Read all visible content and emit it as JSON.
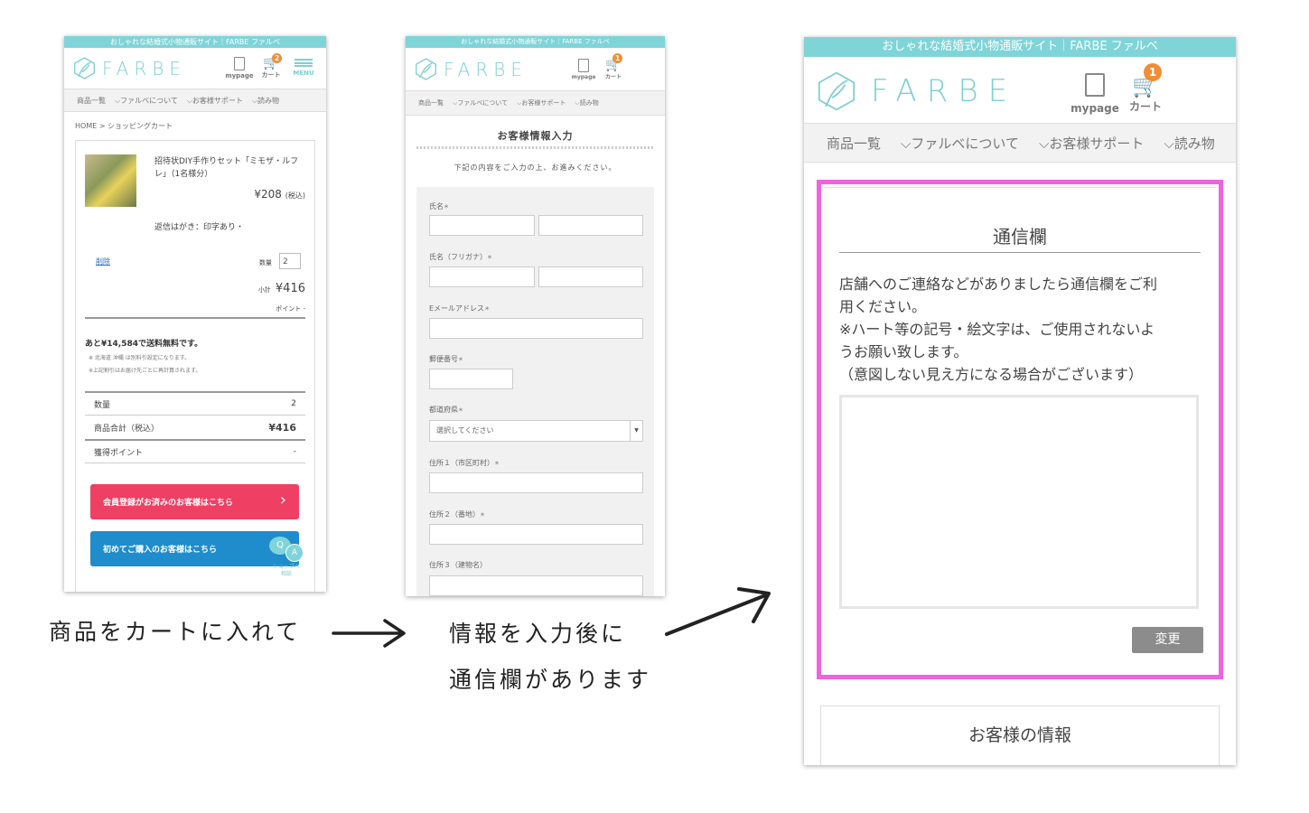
{
  "site": {
    "tagline": "おしゃれな結婚式小物通販サイト｜FARBE ファルベ",
    "logo_text": "FARBE",
    "mypage_label": "mypage",
    "cart_label": "カート",
    "menu_label": "MENU"
  },
  "nav": [
    "商品一覧",
    "ファルベについて",
    "お客様サポート",
    "読み物"
  ],
  "cart_screen": {
    "cart_badge": "2",
    "breadcrumb": "HOME > ショッピングカート",
    "product_name": "招待状DIY手作りセット「ミモザ・ルフレ」（1名様分）",
    "price": "¥208",
    "tax_note": "(税込)",
    "option": "返信はがき：印字あり・",
    "delete_label": "削除",
    "qty_label": "数量",
    "qty_value": "2",
    "subtotal_label": "小計",
    "subtotal_value": "¥416",
    "point_label": "ポイント",
    "point_value": "-",
    "free_shipping": "あと¥14,584で送料無料です。",
    "note1": "※ 北海道 沖縄 は別料引設定になります。",
    "note2": "※上記割引はお届け先ごとに再計算されます。",
    "summary": [
      {
        "label": "数量",
        "value": "2"
      },
      {
        "label": "商品合計（税込）",
        "value": "¥416"
      },
      {
        "label": "獲得ポイント",
        "value": "-"
      }
    ],
    "member_button": "会員登録がお済みのお客様はこちら",
    "first_button": "初めてご購入のお客様はこちら",
    "consult_label": "ショップへ相談"
  },
  "form_screen": {
    "cart_badge": "1",
    "title": "お客様情報入力",
    "intro": "下記の内容をご入力の上、お進みください。",
    "fields": {
      "name": "氏名",
      "kana": "氏名（フリガナ）",
      "email": "Eメールアドレス",
      "zip": "郵便番号",
      "pref": "都道府県",
      "pref_placeholder": "選択してください",
      "addr1": "住所１（市区町村）",
      "addr2": "住所２（番地）",
      "addr3": "住所３（建物名）"
    },
    "required_mark": "＊"
  },
  "comm_screen": {
    "cart_badge": "1",
    "section_title": "通信欄",
    "desc1": "店舗へのご連絡などがありましたら通信欄をご利",
    "desc2": "用ください。",
    "desc3": "※ハート等の記号・絵文字は、ご使用されないよ",
    "desc4": "うお願い致します。",
    "desc5": "（意図しない見え方になる場合がございます）",
    "change_button": "変更",
    "customer_info": "お客様の情報",
    "highlight_color": "#f062e0"
  },
  "captions": {
    "step1": "商品をカートに入れて",
    "step2_line1": "情報を入力後に",
    "step2_line2": "通信欄があります"
  },
  "colors": {
    "accent": "#7fd4d8",
    "badge": "#f08d35",
    "member_button": "#ef3f63",
    "first_button": "#1f8ccc",
    "highlight": "#f062e0"
  }
}
